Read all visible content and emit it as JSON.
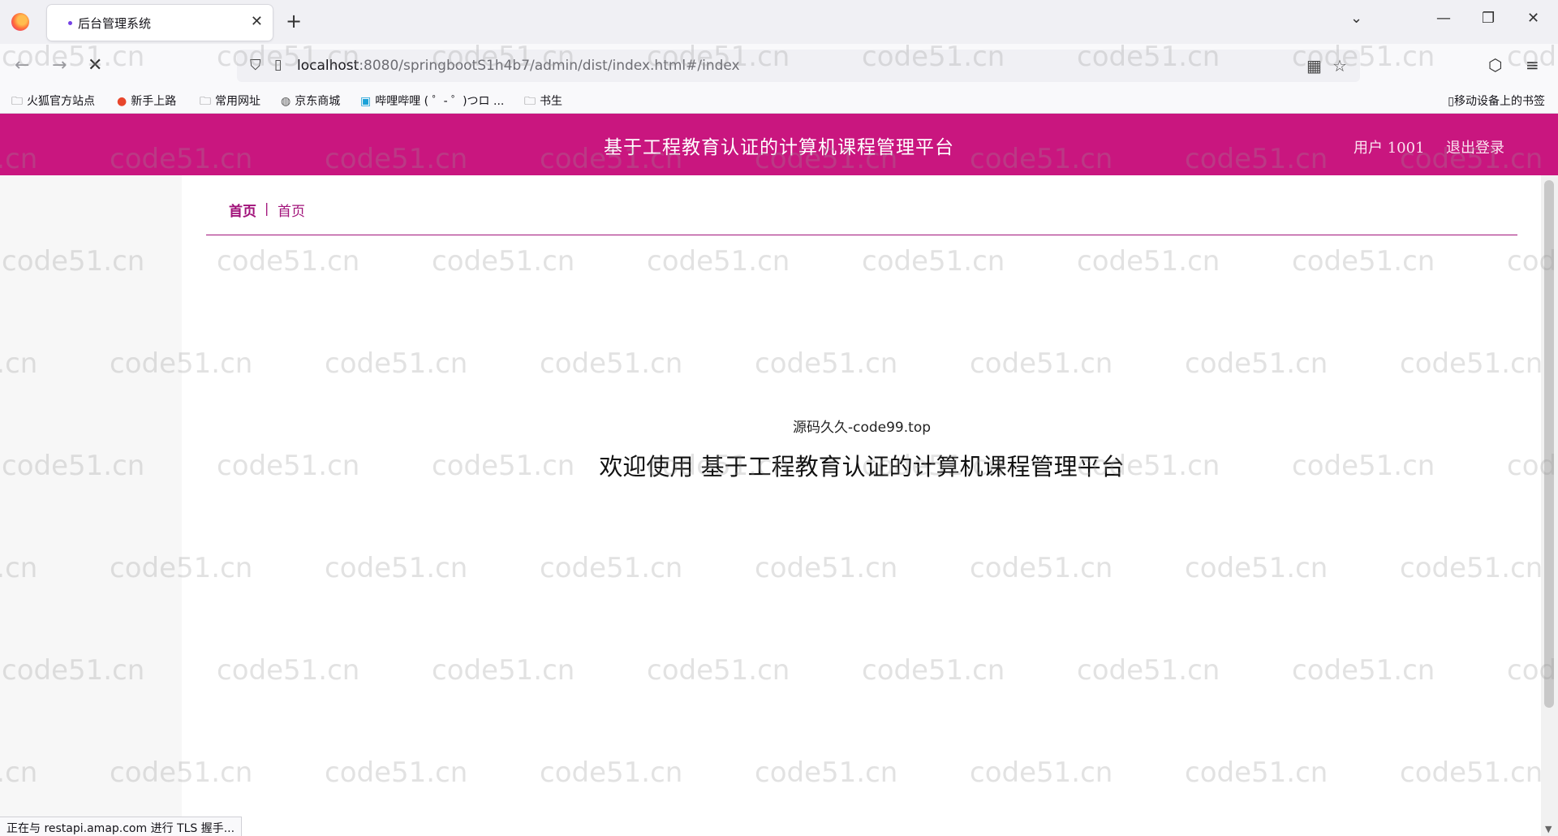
{
  "browser": {
    "tab_title": "后台管理系统",
    "url_host": "localhost",
    "url_rest": ":8080/springbootS1h4b7/admin/dist/index.html#/index",
    "bookmarks": [
      {
        "label": "火狐官方站点",
        "icon": "folder-icon"
      },
      {
        "label": "新手上路",
        "icon": "firefox-icon"
      },
      {
        "label": "常用网址",
        "icon": "folder-icon"
      },
      {
        "label": "京东商城",
        "icon": "globe-icon"
      },
      {
        "label": "哔哩哔哩 ( ゜- ゜)つロ ...",
        "icon": "bilibili-icon"
      },
      {
        "label": "书生",
        "icon": "folder-icon"
      }
    ],
    "mobile_bookmarks": "移动设备上的书签",
    "status_text": "正在与 restapi.amap.com 进行 TLS 握手..."
  },
  "app": {
    "title": "基于工程教育认证的计算机课程管理平台",
    "user": "用户 1001",
    "logout": "退出登录",
    "breadcrumb": {
      "home": "首页",
      "separator": "|",
      "current": "首页"
    },
    "source": "源码久久-code99.top",
    "welcome": "欢迎使用 基于工程教育认证的计算机课程管理平台",
    "accent_color": "#c9167f"
  },
  "watermark": "code51.cn"
}
